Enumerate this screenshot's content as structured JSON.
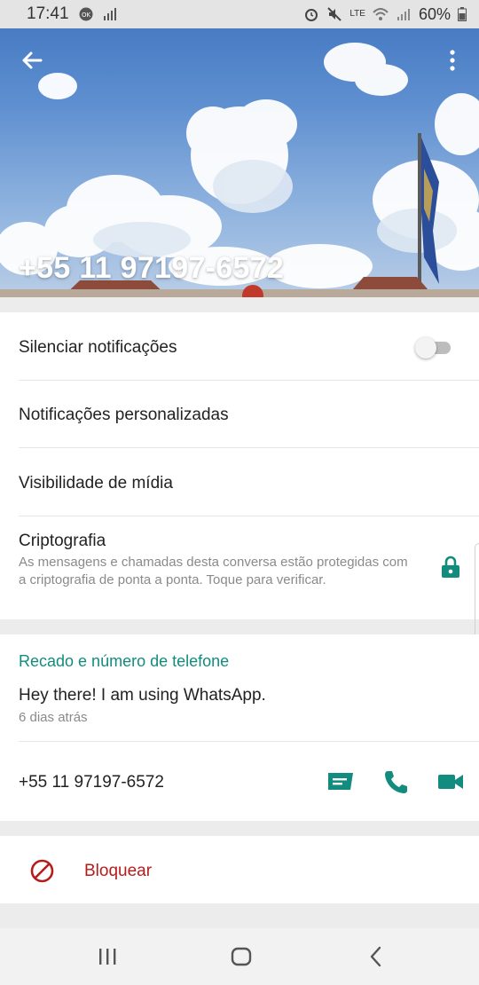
{
  "status_bar": {
    "time": "17:41",
    "battery": "60%",
    "network": "LTE"
  },
  "header": {
    "title": "+55 11 97197-6572",
    "back_icon": "arrow-left-icon",
    "menu_icon": "more-vert-icon"
  },
  "settings": {
    "mute_label": "Silenciar notificações",
    "mute_enabled": false,
    "custom_notifications_label": "Notificações personalizadas",
    "media_visibility_label": "Visibilidade de mídia",
    "encryption_title": "Criptografia",
    "encryption_description": "As mensagens e chamadas desta conversa estão protegidas com a criptografia de ponta a ponta. Toque para verificar."
  },
  "about": {
    "section_title": "Recado e número de telefone",
    "status_text": "Hey there! I am using WhatsApp.",
    "status_time": "6 dias atrás",
    "phone": "+55 11 97197-6572"
  },
  "block": {
    "label": "Bloquear"
  },
  "colors": {
    "accent": "#128c7e",
    "danger": "#b71c1c"
  }
}
